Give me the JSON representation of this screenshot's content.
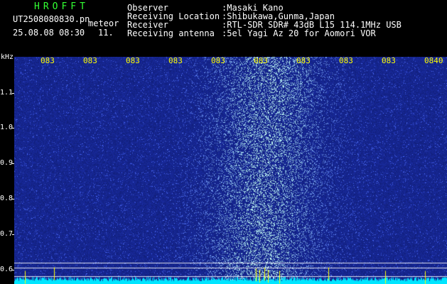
{
  "header": {
    "brand": "HROFFT",
    "filename": "UT2508080830.pn",
    "mode_label": "meteor",
    "datetime": "25.08.08 08:30",
    "count": "11.",
    "info": [
      {
        "label": "Observer",
        "value": ":Masaki Kano"
      },
      {
        "label": "Receiving Location",
        "value": ":Shibukawa,Gunma,Japan"
      },
      {
        "label": "Receiver",
        "value": ":RTL-SDR SDR# 43dB L15 114.1MHz USB"
      },
      {
        "label": "Receiving antenna",
        "value": ":5el Yagi Az 20 for Aomori VOR"
      }
    ]
  },
  "axis": {
    "y_unit": "kHz",
    "y_ticks": [
      "1.1",
      "1.0",
      "0.9",
      "0.8",
      "0.7",
      "0.6"
    ],
    "x_ticks": [
      "083",
      "083",
      "083",
      "083",
      "083",
      "083",
      "083",
      "083",
      "083",
      "0840"
    ]
  },
  "colors": {
    "background": "#000000",
    "spectrogram_base": "#101c78",
    "signal": "#9fd8ff",
    "noise_band": "#00e5ff",
    "x_tick": "#ffff00",
    "brand": "#33ff33"
  }
}
